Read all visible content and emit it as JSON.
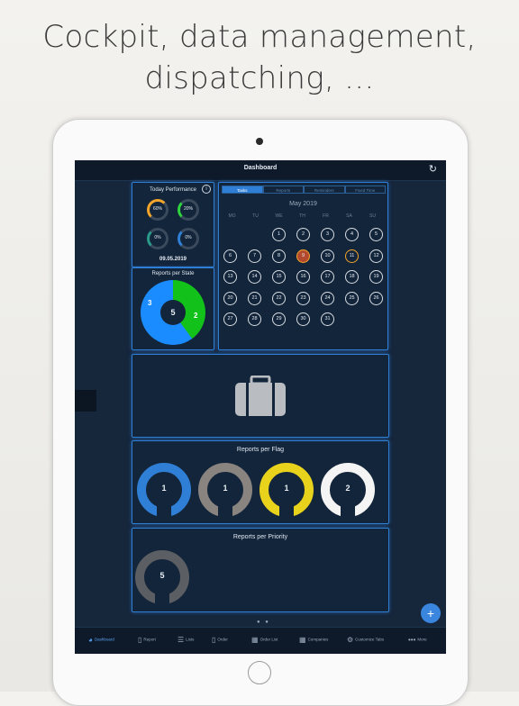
{
  "headline": {
    "line1": "Cockpit, data management,",
    "line2": "dispatching, ..."
  },
  "app": {
    "title": "Dashboard"
  },
  "today_performance": {
    "title": "Today Performance",
    "gauges": [
      "60%",
      "20%",
      "0%",
      "0%"
    ],
    "date": "09.05.2019"
  },
  "reports_per_state": {
    "title": "Reports per State",
    "total": "5",
    "left_value": "3",
    "right_value": "2"
  },
  "calendar": {
    "tabs": [
      "Tasks",
      "Reports",
      "Reminders",
      "Fixed Time"
    ],
    "month": "May 2019",
    "weekdays": [
      "MO",
      "TU",
      "WE",
      "TH",
      "FR",
      "SA",
      "SU"
    ],
    "days": [
      "1",
      "2",
      "3",
      "4",
      "5",
      "6",
      "7",
      "8",
      "9",
      "10",
      "11",
      "12",
      "13",
      "14",
      "15",
      "16",
      "17",
      "18",
      "19",
      "20",
      "21",
      "22",
      "23",
      "24",
      "25",
      "26",
      "27",
      "28",
      "29",
      "30",
      "31"
    ],
    "selected_day": "9",
    "highlighted_day": "11"
  },
  "reports_per_flag": {
    "title": "Reports per Flag",
    "rings": [
      {
        "value": "1",
        "color": "#2f7fd6"
      },
      {
        "value": "1",
        "color": "#8a8480"
      },
      {
        "value": "1",
        "color": "#e9d21c"
      },
      {
        "value": "2",
        "color": "#f4f4f4"
      }
    ]
  },
  "reports_per_priority": {
    "title": "Reports per Priority",
    "value": "5"
  },
  "tabbar": {
    "items": [
      "Dashboard",
      "Report",
      "Lists",
      "Order",
      "Order List",
      "Companies",
      "Customize Tabs",
      "More"
    ]
  },
  "fab": {
    "label": "+"
  },
  "icons": [
    "refresh-icon",
    "info-icon",
    "briefcase-icon",
    "plus-icon",
    "dashboard-icon",
    "report-icon",
    "lists-icon",
    "order-icon",
    "order-list-icon",
    "companies-icon",
    "customize-tabs-icon",
    "more-icon"
  ]
}
